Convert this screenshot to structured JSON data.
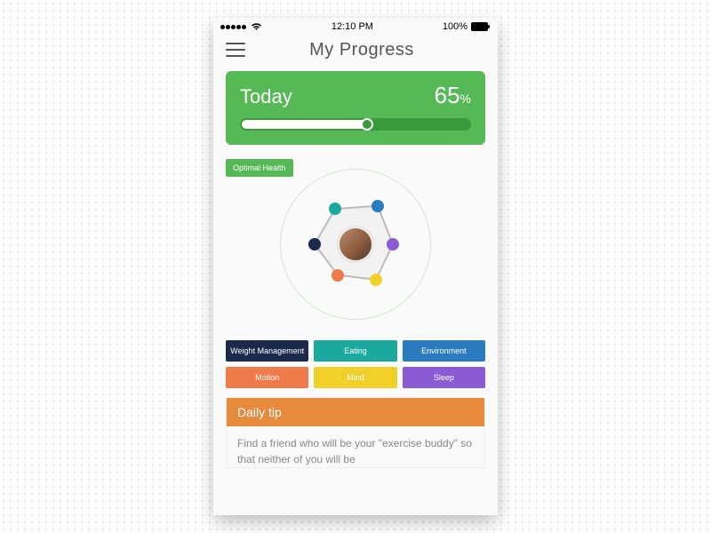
{
  "statusbar": {
    "time": "12:10 PM",
    "battery": "100%"
  },
  "header": {
    "title": "My Progress"
  },
  "today": {
    "label": "Today",
    "percent_value": "65",
    "percent_symbol": "%",
    "progress_percent": 55
  },
  "radar": {
    "label": "Optimal Health",
    "nodes": [
      {
        "name": "weight",
        "color": "#1b2a4a",
        "angle": -180,
        "r": 46
      },
      {
        "name": "eating",
        "color": "#1aa99c",
        "angle": -120,
        "r": 46
      },
      {
        "name": "environment",
        "color": "#2a7bbf",
        "angle": -60,
        "r": 50
      },
      {
        "name": "sleep",
        "color": "#8a5bd4",
        "angle": 0,
        "r": 42
      },
      {
        "name": "mind",
        "color": "#f2d02a",
        "angle": 60,
        "r": 46
      },
      {
        "name": "motion",
        "color": "#ef7a4a",
        "angle": 120,
        "r": 40
      }
    ]
  },
  "chips": [
    {
      "label": "Weight Management",
      "color": "#1b2a4a",
      "name": "weight"
    },
    {
      "label": "Eating",
      "color": "#1aa99c",
      "name": "eating"
    },
    {
      "label": "Environment",
      "color": "#2a7bbf",
      "name": "environment"
    },
    {
      "label": "Motion",
      "color": "#ef7a4a",
      "name": "motion"
    },
    {
      "label": "Mind",
      "color": "#f2d02a",
      "name": "mind"
    },
    {
      "label": "Sleep",
      "color": "#8a5bd4",
      "name": "sleep"
    }
  ],
  "tip": {
    "heading": "Daily tip",
    "body": "Find a friend who will be your \"exercise buddy\" so that neither of you will be"
  },
  "chart_data": {
    "type": "bar",
    "title": "Today progress",
    "categories": [
      "Today"
    ],
    "values": [
      65
    ],
    "ylim": [
      0,
      100
    ],
    "ylabel": "%"
  }
}
